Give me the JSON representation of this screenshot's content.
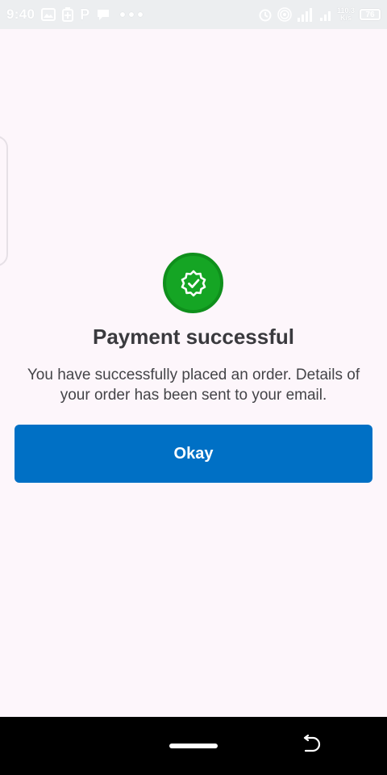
{
  "status_bar": {
    "time": "9:40",
    "net_speed_value": "110.3",
    "net_speed_unit": "K/s",
    "battery": "76",
    "icons": [
      "image-icon",
      "battery-saver-icon",
      "p-app-icon",
      "chat-icon",
      "more-dots-icon",
      "alarm-icon",
      "hotspot-icon",
      "signal-4g-icon",
      "signal-icon",
      "battery-icon"
    ],
    "p_letter": "P"
  },
  "dialog": {
    "icon": "verified-check-icon",
    "title": "Payment successful",
    "message": "You have successfully placed an order. Details of your order has been sent to your email.",
    "button_label": "Okay"
  },
  "colors": {
    "background": "#fdf6fb",
    "success": "#15a524",
    "accent": "#0070c5",
    "nav": "#000000"
  },
  "nav_bar": {
    "icons": [
      "home-pill-icon",
      "back-icon"
    ]
  }
}
